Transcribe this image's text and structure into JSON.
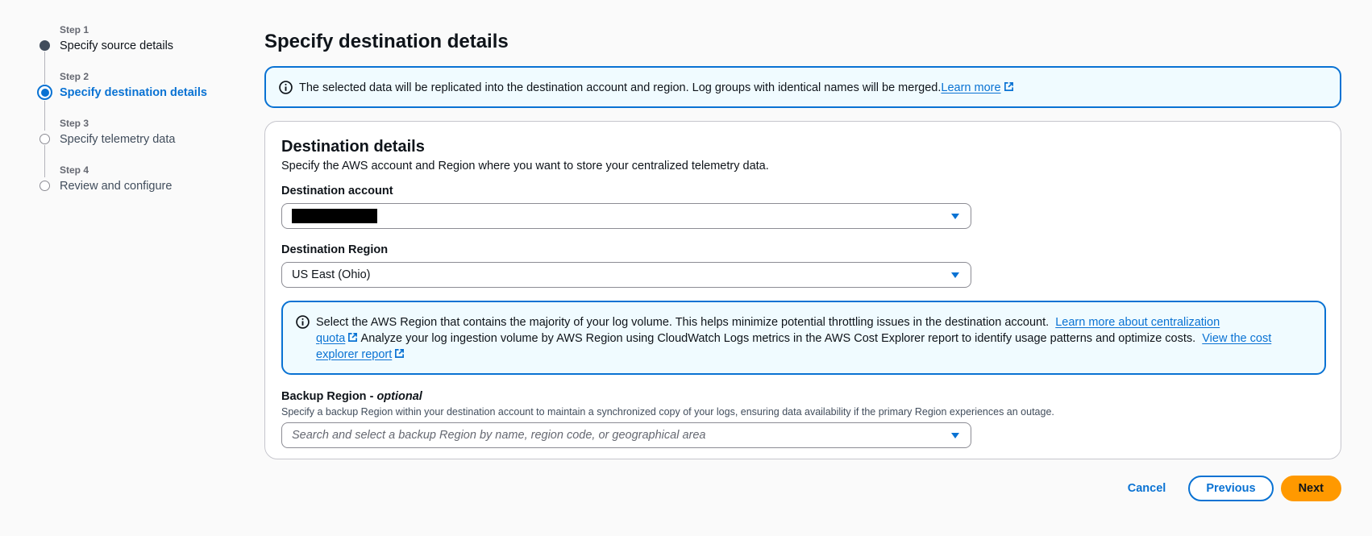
{
  "stepper": {
    "steps": [
      {
        "number": "Step 1",
        "label": "Specify source details",
        "state": "done"
      },
      {
        "number": "Step 2",
        "label": "Specify destination details",
        "state": "active"
      },
      {
        "number": "Step 3",
        "label": "Specify telemetry data",
        "state": "pending"
      },
      {
        "number": "Step 4",
        "label": "Review and configure",
        "state": "pending"
      }
    ]
  },
  "main": {
    "title": "Specify destination details",
    "top_info": {
      "text": "The selected data will be replicated into the destination account and region. Log groups with identical names will be merged.",
      "link": "Learn more"
    },
    "destination": {
      "title": "Destination details",
      "description": "Specify the AWS account and Region where you want to store your centralized telemetry data.",
      "account": {
        "label": "Destination account",
        "value": "[redacted]"
      },
      "region": {
        "label": "Destination Region",
        "value": "US East (Ohio)"
      },
      "region_info": {
        "text1": "Select the AWS Region that contains the majority of your log volume. This helps minimize potential throttling issues in the destination account.",
        "link1_part1": "Learn more about centralization",
        "link1_part2": "quota",
        "text2": "Analyze your log ingestion volume by AWS Region using CloudWatch Logs metrics in the AWS Cost Explorer report to identify usage patterns and optimize costs.",
        "link2_part1": "View the cost",
        "link2_part2": "explorer report"
      },
      "backup": {
        "label": "Backup Region - ",
        "label_optional": "optional",
        "description": "Specify a backup Region within your destination account to maintain a synchronized copy of your logs, ensuring data availability if the primary Region experiences an outage.",
        "placeholder": "Search and select a backup Region by name, region code, or geographical area"
      }
    }
  },
  "actions": {
    "cancel": "Cancel",
    "previous": "Previous",
    "next": "Next"
  },
  "colors": {
    "accent": "#0972d3",
    "primary_button": "#ff9900",
    "info_background": "#f0fbff"
  }
}
